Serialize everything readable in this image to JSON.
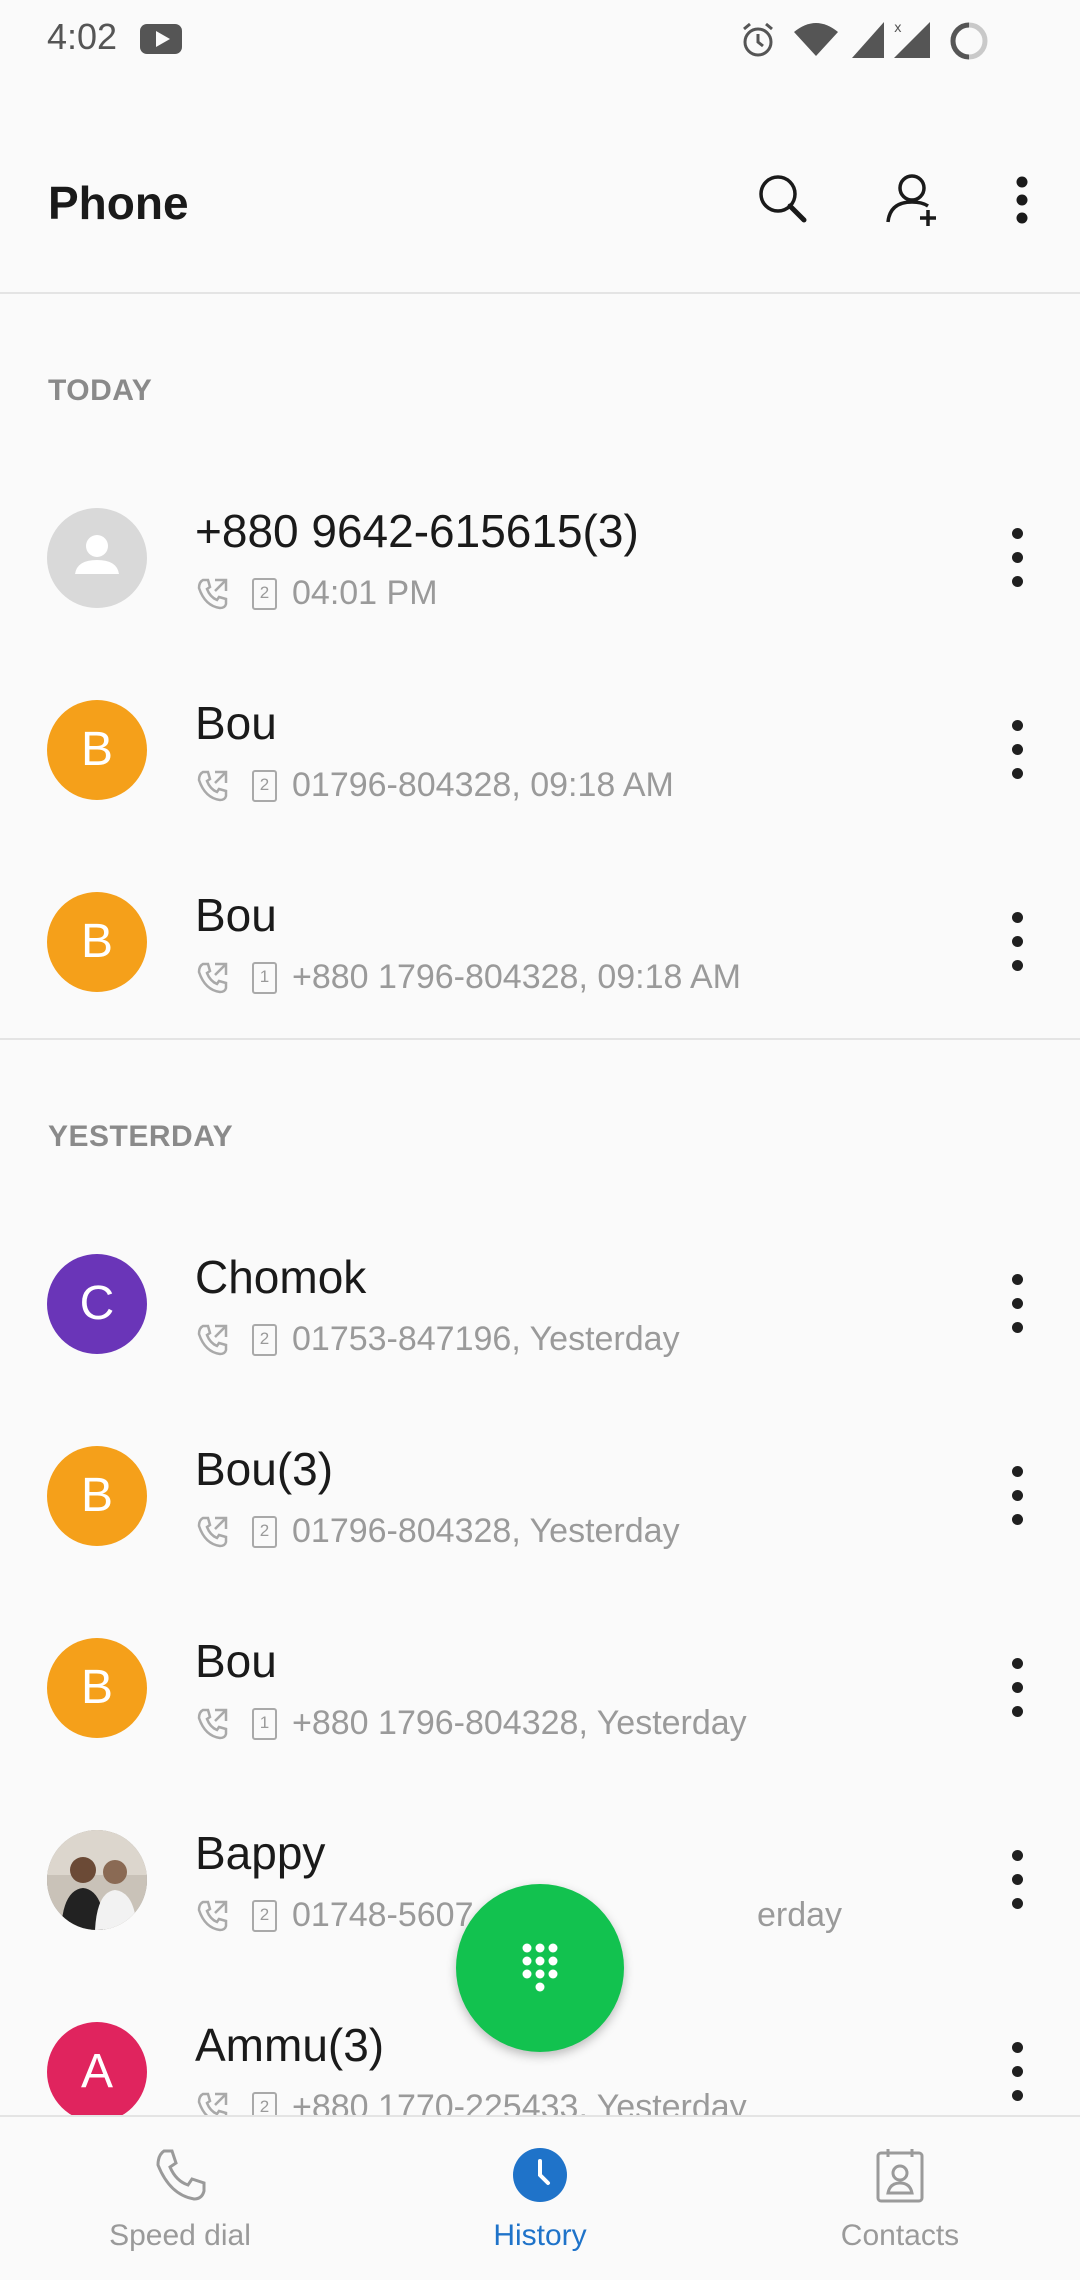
{
  "status_bar": {
    "time": "4:02",
    "icons": [
      "youtube-icon",
      "alarm-icon",
      "wifi-icon",
      "signal-icon",
      "signal-no-data-icon",
      "battery-icon"
    ]
  },
  "app_bar": {
    "title": "Phone",
    "actions": [
      "search-icon",
      "add-contact-icon",
      "more-options-icon"
    ]
  },
  "sections": {
    "today": {
      "header": "TODAY",
      "rows": [
        {
          "name": "+880 9642-615615(3)",
          "detail": "04:01 PM",
          "sim": "2",
          "avatar_letter": "",
          "avatar_color": "#d9d9d9"
        },
        {
          "name": "Bou",
          "detail": "01796-804328, 09:18 AM",
          "sim": "2",
          "avatar_letter": "B",
          "avatar_color": "#f5a01a"
        },
        {
          "name": "Bou",
          "detail": "+880 1796-804328, 09:18 AM",
          "sim": "1",
          "avatar_letter": "B",
          "avatar_color": "#f5a01a"
        }
      ]
    },
    "yesterday": {
      "header": "YESTERDAY",
      "rows": [
        {
          "name": "Chomok",
          "detail": "01753-847196, Yesterday",
          "sim": "2",
          "avatar_letter": "C",
          "avatar_color": "#6a35b8"
        },
        {
          "name": "Bou(3)",
          "detail": "01796-804328, Yesterday",
          "sim": "2",
          "avatar_letter": "B",
          "avatar_color": "#f5a01a"
        },
        {
          "name": "Bou",
          "detail": "+880 1796-804328, Yesterday",
          "sim": "1",
          "avatar_letter": "B",
          "avatar_color": "#f5a01a"
        },
        {
          "name": "Bappy",
          "detail": "01748-5607",
          "detail_tail": "erday",
          "sim": "2",
          "avatar_letter": "",
          "avatar_color": "#8c8c8c"
        },
        {
          "name": "Ammu(3)",
          "detail": "+880 1770-225433, Yesterday",
          "sim": "2",
          "avatar_letter": "A",
          "avatar_color": "#e0245e"
        }
      ]
    }
  },
  "fab": {
    "icon": "dialpad-icon",
    "color": "#12c24f"
  },
  "bottom_nav": {
    "items": [
      {
        "label": "Speed dial",
        "icon": "phone-icon",
        "active": false
      },
      {
        "label": "History",
        "icon": "clock-icon",
        "active": true
      },
      {
        "label": "Contacts",
        "icon": "contact-card-icon",
        "active": false
      }
    ],
    "active_color": "#1f73c9"
  }
}
